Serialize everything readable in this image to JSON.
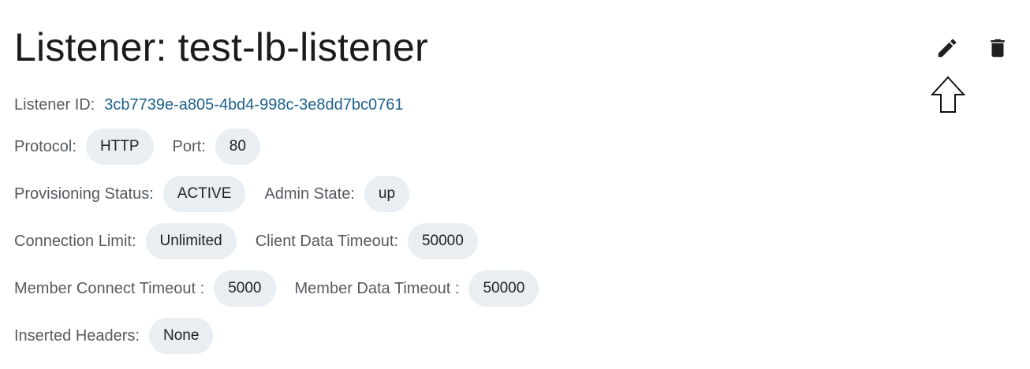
{
  "header": {
    "title": "Listener: test-lb-listener",
    "edit_icon": "pencil-icon",
    "delete_icon": "trash-icon"
  },
  "listener_id": {
    "label": "Listener ID:",
    "value": "3cb7739e-a805-4bd4-998c-3e8dd7bc0761"
  },
  "rows": [
    {
      "fields": [
        {
          "label": "Protocol:",
          "value": "HTTP"
        },
        {
          "label": "Port:",
          "value": "80"
        }
      ]
    },
    {
      "fields": [
        {
          "label": "Provisioning Status:",
          "value": "ACTIVE"
        },
        {
          "label": "Admin State:",
          "value": "up"
        }
      ]
    },
    {
      "fields": [
        {
          "label": "Connection Limit:",
          "value": "Unlimited"
        },
        {
          "label": "Client Data Timeout:",
          "value": "50000"
        }
      ]
    },
    {
      "fields": [
        {
          "label": "Member Connect Timeout :",
          "value": "5000"
        },
        {
          "label": "Member Data Timeout :",
          "value": "50000"
        }
      ]
    },
    {
      "fields": [
        {
          "label": "Inserted Headers:",
          "value": "None"
        }
      ]
    }
  ],
  "colors": {
    "link": "#1d5f8a",
    "chip_bg": "#e9eef3"
  }
}
